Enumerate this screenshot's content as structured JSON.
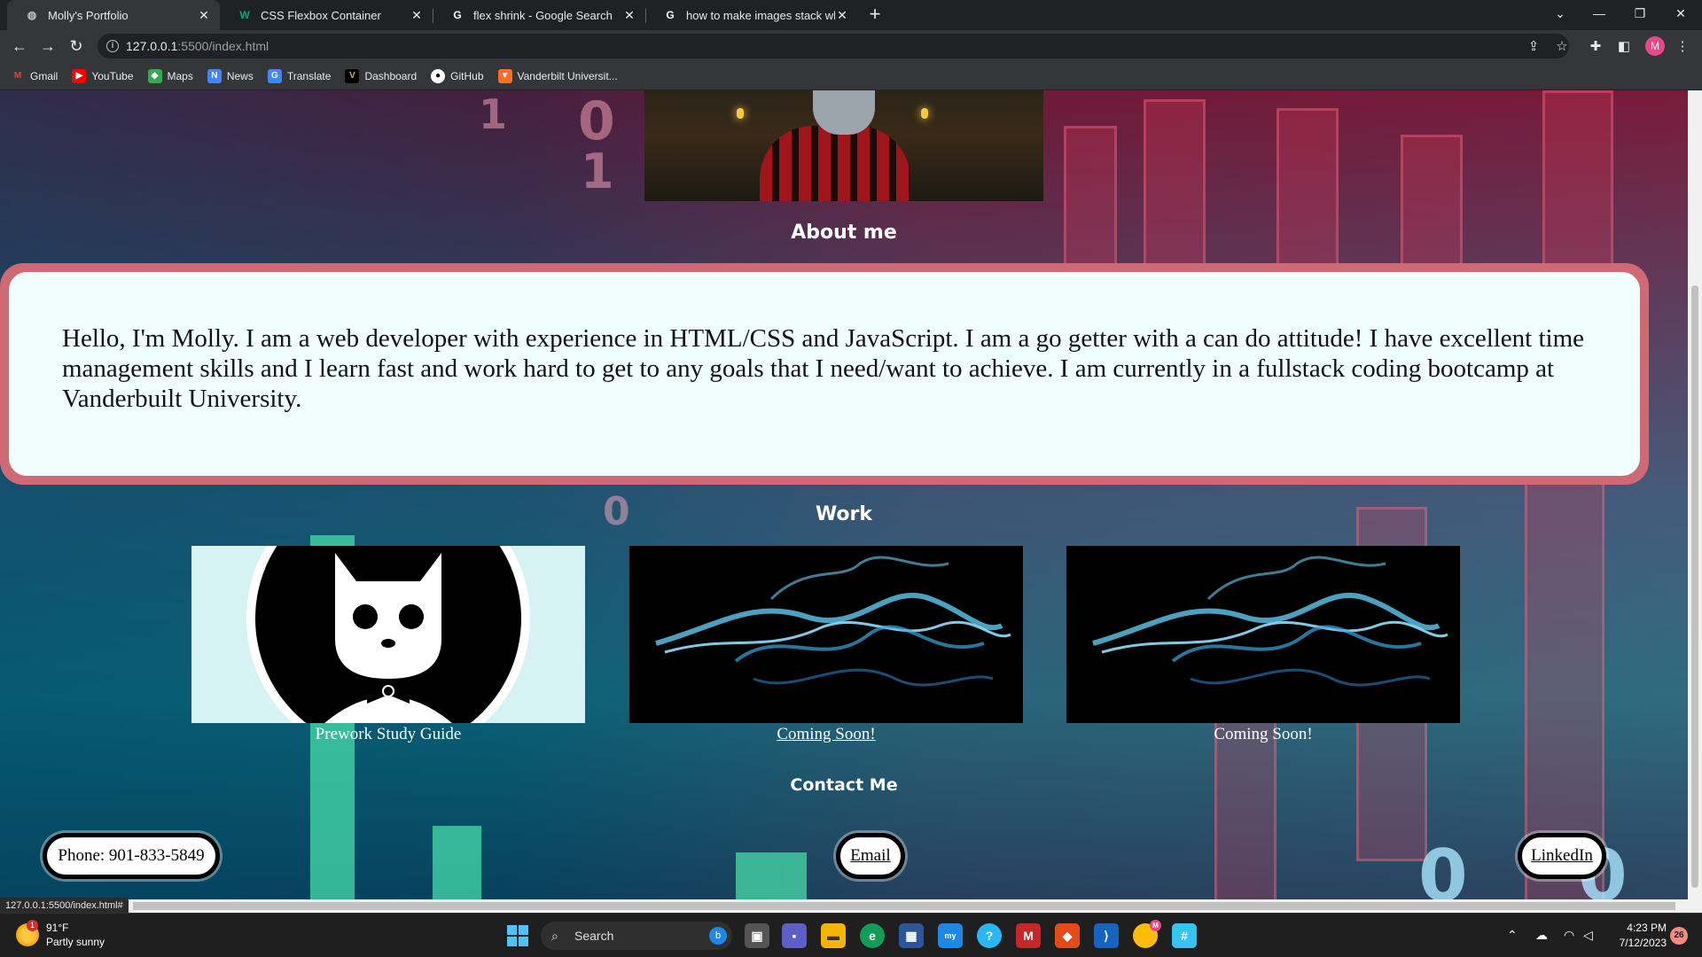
{
  "browser": {
    "tabs": [
      {
        "title": "Molly's Portfolio",
        "icon": "globe-icon"
      },
      {
        "title": "CSS Flexbox Container",
        "icon": "w3schools-icon"
      },
      {
        "title": "flex shrink - Google Search",
        "icon": "google-icon"
      },
      {
        "title": "how to make images stack when",
        "icon": "google-icon"
      }
    ],
    "url_host": "127.0.0.1",
    "url_path": ":5500/index.html",
    "profile_initial": "M",
    "bookmarks": [
      "Gmail",
      "YouTube",
      "Maps",
      "News",
      "Translate",
      "Dashboard",
      "GitHub",
      "Vanderbilt Universit..."
    ],
    "status_url": "127.0.0.1:5500/index.html#"
  },
  "page": {
    "about_title": "About me",
    "about_text": "Hello, I'm Molly. I am a web developer with experience in HTML/CSS and JavaScript. I am a go getter with a can do attitude! I have excellent time management skills and I learn fast and work hard to get to any goals that I need/want to achieve. I am currently in a fullstack coding bootcamp at Vanderbuilt University.",
    "work_title": "Work",
    "projects": [
      {
        "label": "Prework Study Guide",
        "image": "cat-bowtie-logo"
      },
      {
        "label": "Coming Soon!",
        "image": "blue-smoke"
      },
      {
        "label": "Coming Soon!",
        "image": "blue-smoke"
      }
    ],
    "contact_title": "Contact Me",
    "contact": {
      "phone": "Phone: 901-833-5849",
      "email": "Email",
      "linkedin": "LinkedIn"
    }
  },
  "taskbar": {
    "weather_temp": "91°F",
    "weather_desc": "Partly sunny",
    "weather_badge": "1",
    "search_label": "Search",
    "time": "4:23 PM",
    "date": "7/12/2023",
    "notification_count": "26",
    "chrome_badge": "M"
  },
  "colors": {
    "about_border": "#cf6a74",
    "about_bg": "#f0fffe",
    "taskbar_bg": "#1f1f1f"
  }
}
